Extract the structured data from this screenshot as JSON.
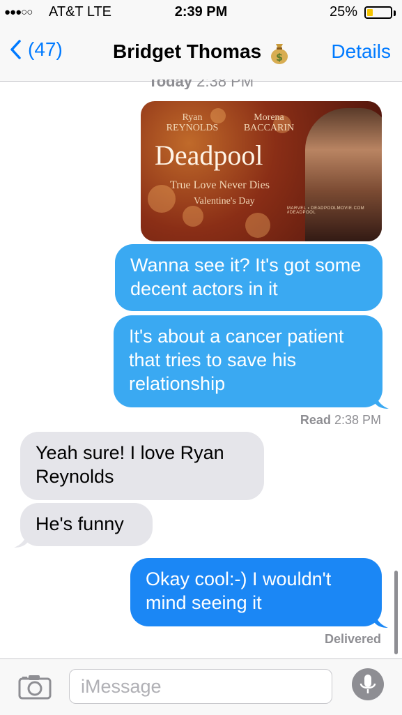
{
  "status_bar": {
    "signal": "●●●○○",
    "carrier": "AT&T  LTE",
    "time": "2:39 PM",
    "battery_percent": "25%",
    "battery_level": 0.25,
    "battery_color": "#f5c400"
  },
  "nav": {
    "back_label": "(47)",
    "contact_name": "Bridget Thomas",
    "contact_emoji_icon": "money-bag-icon",
    "details_label": "Details",
    "accent_color": "#007aff"
  },
  "timestamp_top": {
    "day": "Today",
    "time": "2:38 PM"
  },
  "poster": {
    "actor1_first": "Ryan",
    "actor1_last": "REYNOLDS",
    "actor2_first": "Morena",
    "actor2_last": "BACCARIN",
    "title": "Deadpool",
    "tagline": "True Love Never Dies",
    "date": "Valentine's Day",
    "footer": "MARVEL  ▪  DEADPOOLMOVIE.COM  #DEADPOOL"
  },
  "messages": [
    {
      "sender": "me",
      "text": "Wanna see it? It's got some decent actors in it"
    },
    {
      "sender": "me",
      "text": "It's about a cancer patient that tries to save his relationship"
    },
    {
      "sender": "them",
      "text": "Yeah sure! I love Ryan Reynolds"
    },
    {
      "sender": "them",
      "text": "He's funny"
    },
    {
      "sender": "me",
      "text": "Okay cool:-) I wouldn't mind seeing it"
    }
  ],
  "receipt_read": {
    "label": "Read",
    "time": "2:38 PM"
  },
  "receipt_delivered": "Delivered",
  "input": {
    "placeholder": "iMessage"
  },
  "icons": {
    "camera": "camera-icon",
    "mic": "microphone-icon",
    "back": "chevron-left-icon"
  }
}
